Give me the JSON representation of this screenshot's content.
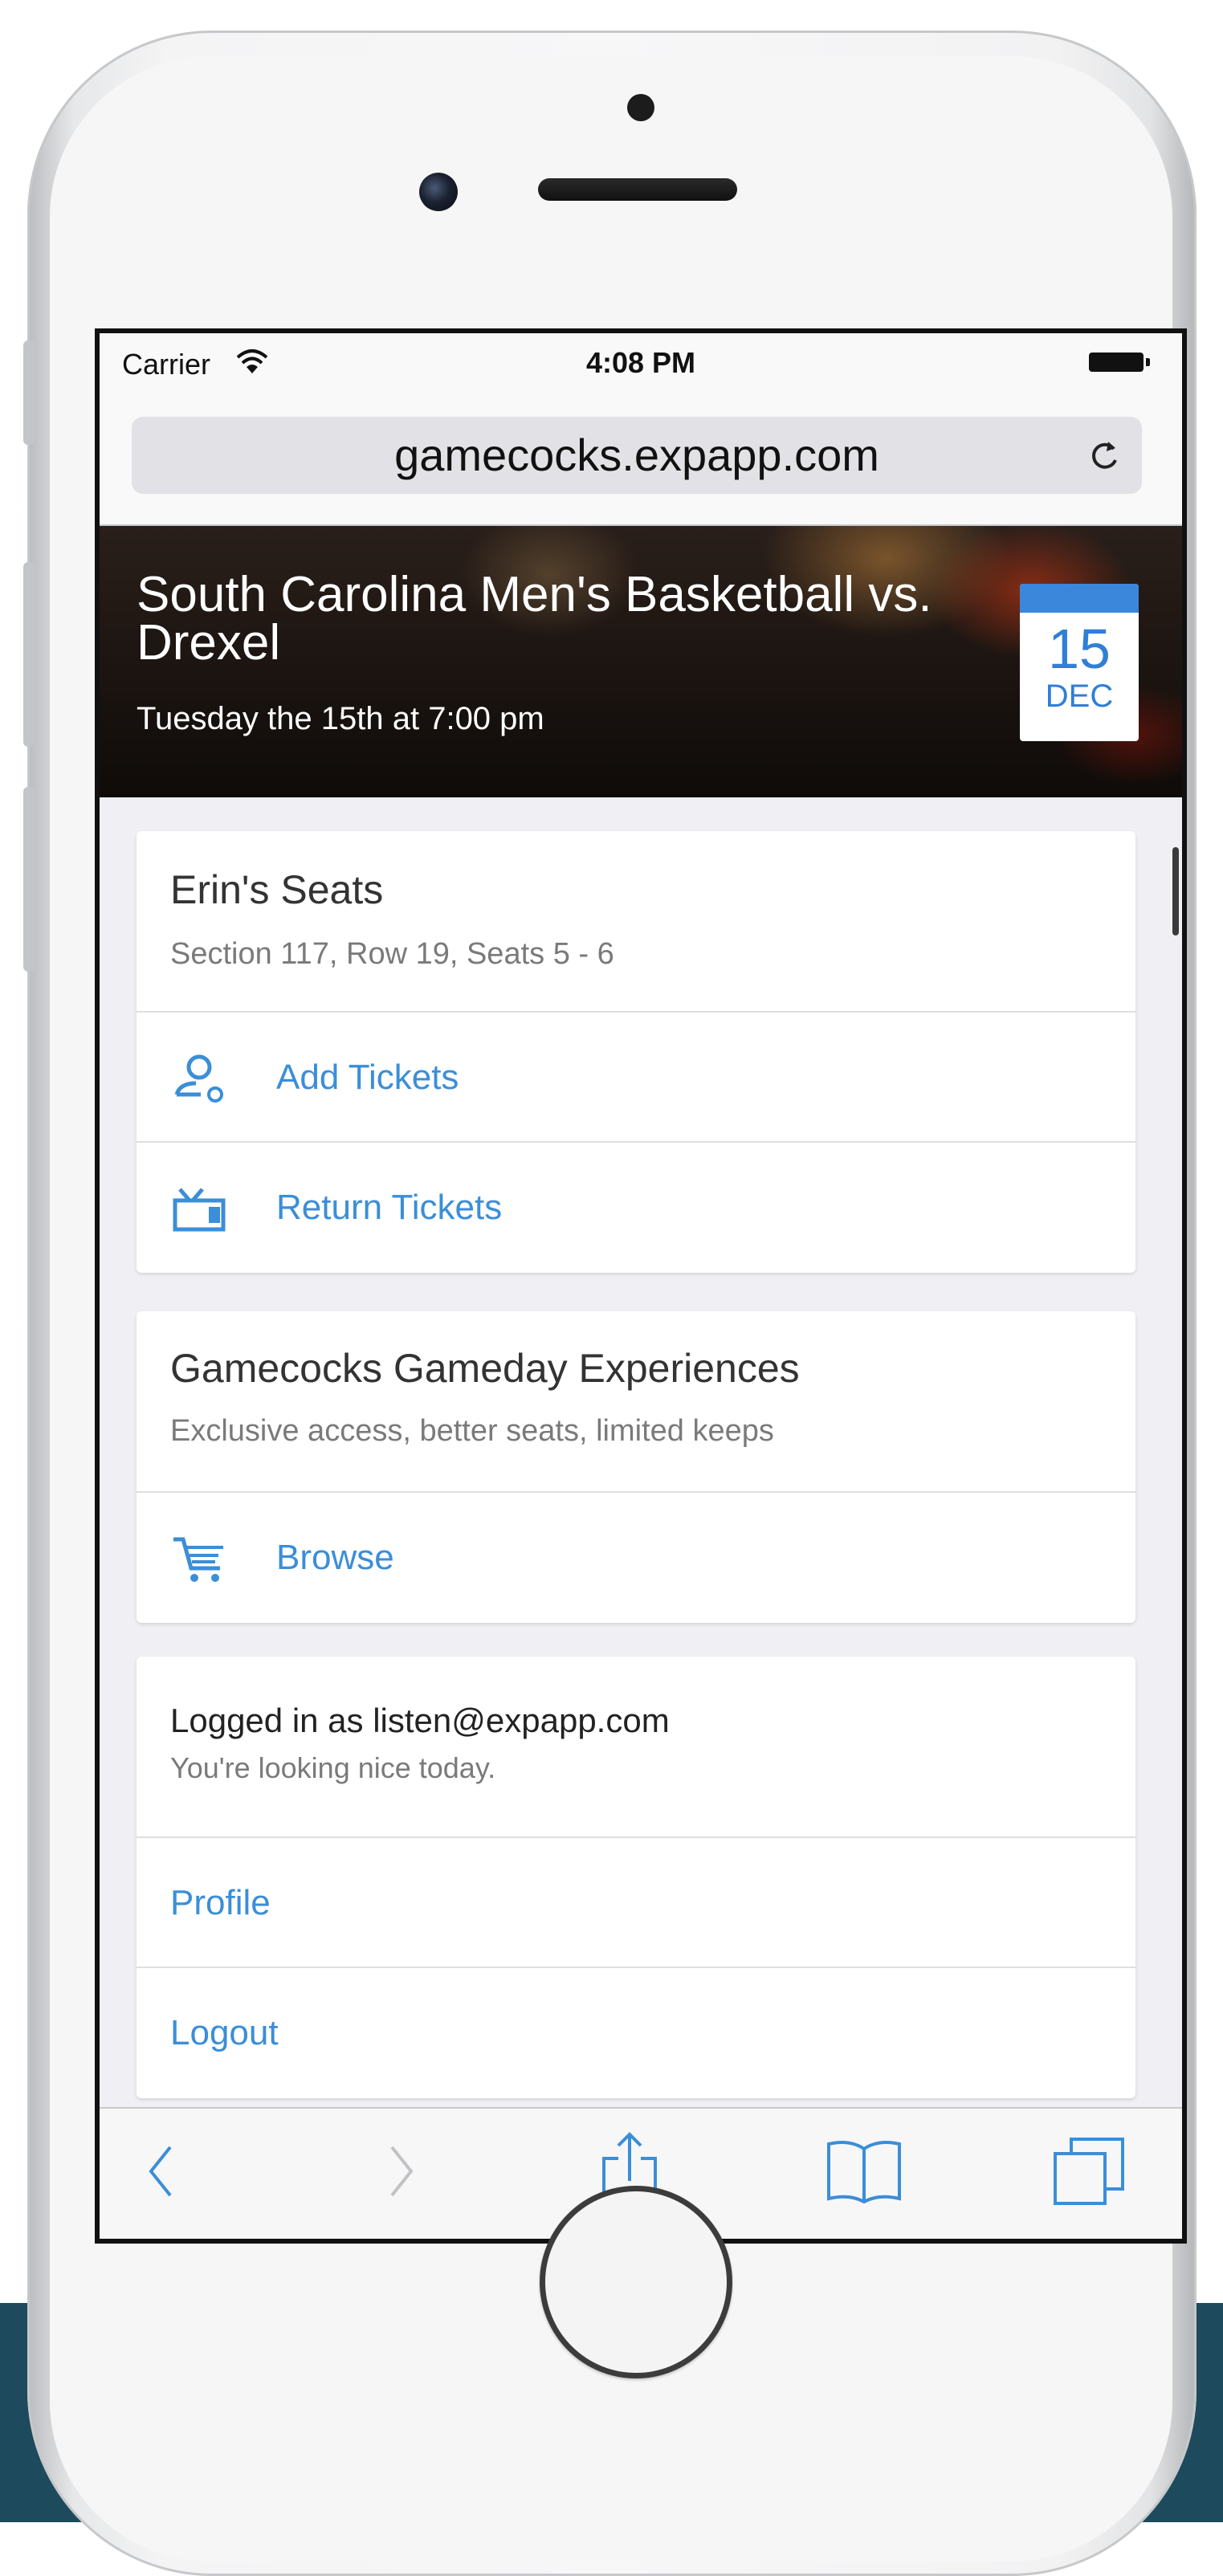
{
  "status_bar": {
    "carrier": "Carrier",
    "time": "4:08 PM"
  },
  "browser": {
    "url": "gamecocks.expapp.com"
  },
  "event": {
    "title": "South Carolina Men's Basketball vs. Drexel",
    "subtitle": "Tuesday the 15th at 7:00 pm",
    "date_day": "15",
    "date_month": "DEC"
  },
  "seats_card": {
    "title": "Erin's Seats",
    "subtitle": "Section 117, Row 19, Seats 5 - 6",
    "actions": [
      {
        "label": "Add Tickets",
        "icon": "add-user-icon"
      },
      {
        "label": "Return Tickets",
        "icon": "return-ticket-icon"
      }
    ]
  },
  "experiences_card": {
    "title": "Gamecocks Gameday Experiences",
    "subtitle": "Exclusive access, better seats, limited keeps",
    "actions": [
      {
        "label": "Browse",
        "icon": "cart-icon"
      }
    ]
  },
  "account_card": {
    "title": "Logged in as listen@expapp.com",
    "subtitle": "You're looking nice today.",
    "links": [
      "Profile",
      "Logout"
    ]
  },
  "colors": {
    "accent": "#3b8ed8",
    "badge_blue": "#3a87dc",
    "floor": "#1d4a5c"
  },
  "toolbar_icons": [
    "back-icon",
    "forward-icon",
    "share-icon",
    "bookmarks-icon",
    "tabs-icon"
  ]
}
